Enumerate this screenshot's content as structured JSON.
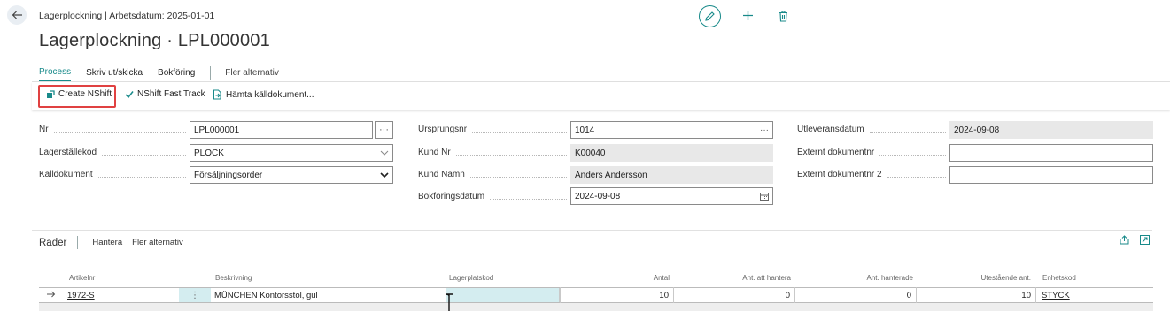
{
  "header": {
    "caption": "Lagerplockning | Arbetsdatum: 2025-01-01",
    "title": "Lagerplockning · LPL000001"
  },
  "menu": {
    "items": [
      "Process",
      "Skriv ut/skicka",
      "Bokföring",
      "Fler alternativ"
    ]
  },
  "actions": {
    "create_nshift": "Create NShift",
    "fast_track": "NShift Fast Track",
    "hamta": "Hämta källdokument..."
  },
  "fields": {
    "nr": {
      "label": "Nr",
      "value": "LPL000001"
    },
    "lagerstallekod": {
      "label": "Lagerställekod",
      "value": "PLOCK"
    },
    "kalldokument": {
      "label": "Källdokument",
      "value": "Försäljningsorder"
    },
    "ursprungsnr": {
      "label": "Ursprungsnr",
      "value": "1014"
    },
    "kund_nr": {
      "label": "Kund Nr",
      "value": "K00040"
    },
    "kund_namn": {
      "label": "Kund Namn",
      "value": "Anders Andersson"
    },
    "bokforingsdatum": {
      "label": "Bokföringsdatum",
      "value": "2024-09-08"
    },
    "utleveransdatum": {
      "label": "Utleveransdatum",
      "value": "2024-09-08"
    },
    "externt_dokumentnr": {
      "label": "Externt dokumentnr",
      "value": ""
    },
    "externt_dokumentnr_2": {
      "label": "Externt dokumentnr 2",
      "value": ""
    }
  },
  "lines": {
    "title": "Rader",
    "menu": [
      "Hantera",
      "Fler alternativ"
    ],
    "columns": [
      "Artikelnr",
      "Beskrivning",
      "Lagerplatskod",
      "Antal",
      "Ant. att hantera",
      "Ant. hanterade",
      "Utestående ant.",
      "Enhetskod"
    ],
    "rows": [
      {
        "artikelnr": "1972-S",
        "beskrivning": "MÜNCHEN Kontorsstol, gul",
        "lagerplatskod": "",
        "antal": "10",
        "ant_att_hantera": "0",
        "ant_hanterade": "0",
        "utestaende": "10",
        "enhetskod": "STYCK"
      }
    ]
  },
  "colors": {
    "accent": "#188a8a",
    "highlight": "#e04141",
    "readonly_bg": "#e8e8e8",
    "selected_cell": "#d4edf0"
  }
}
